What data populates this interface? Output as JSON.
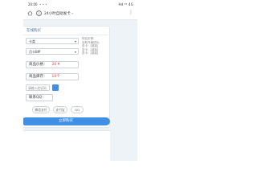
{
  "statusbar": {
    "time": "20:00",
    "dots": "• • •",
    "right": "  Hd ⁴⁶ 4G"
  },
  "addressbar": {
    "url": "24小时自助发卡 ›",
    "menu": "⋮"
  },
  "card": {
    "title": "在线购买",
    "category_select": "卡类",
    "product_select": "月卡BIP",
    "price_label": "商品价格：",
    "price_value": "20 ¥",
    "stock_label": "商品库存：",
    "stock_value": "10个",
    "code_placeholder": "请输入验证码",
    "qq_label": "联系QQ：",
    "help_text": [
      "购买步骤：",
      "自助开通成功，",
      "查卡：[链接]",
      "查卡：[链接]",
      "查卡：[链接]"
    ],
    "pay_options": [
      "微信支付",
      "支付宝",
      "QQ"
    ]
  },
  "submit_label": "立即购买"
}
